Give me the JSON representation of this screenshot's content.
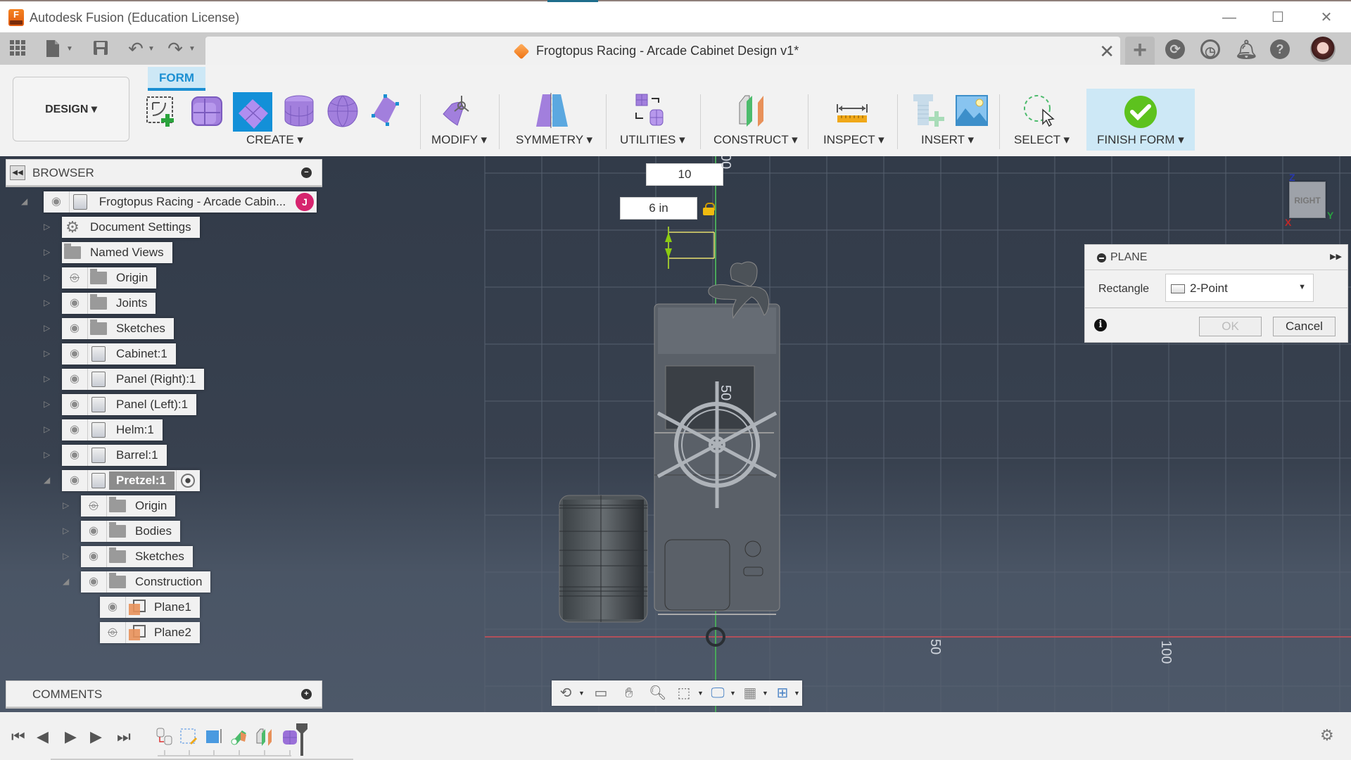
{
  "window": {
    "app_title": "Autodesk Fusion (Education License)",
    "logo_text": "F",
    "controls": {
      "minimize": "—",
      "maximize": "☐",
      "close": "✕"
    }
  },
  "quick_access": {
    "icons": [
      "apps-grid-icon",
      "file-icon",
      "save-icon",
      "undo-icon",
      "redo-icon"
    ]
  },
  "document_tab": {
    "title": "Frogtopus Racing - Arcade Cabinet Design v1*",
    "close": "✕",
    "new_tab": "+"
  },
  "top_right_icons": [
    "extensions-icon",
    "job-status-icon",
    "notifications-icon",
    "help-icon",
    "user-avatar"
  ],
  "ribbon": {
    "workspace": "DESIGN ▾",
    "active_tab": "FORM",
    "groups": [
      {
        "label": "CREATE ▾"
      },
      {
        "label": "MODIFY ▾"
      },
      {
        "label": "SYMMETRY ▾"
      },
      {
        "label": "UTILITIES ▾"
      },
      {
        "label": "CONSTRUCT ▾"
      },
      {
        "label": "INSPECT ▾"
      },
      {
        "label": "INSERT ▾"
      },
      {
        "label": "SELECT ▾"
      },
      {
        "label": "FINISH FORM ▾"
      }
    ],
    "create_tools": [
      "create-sketch",
      "box",
      "plane",
      "cylinder",
      "sphere",
      "face"
    ],
    "active_create_tool": "plane",
    "finish_color": "#5dc21e"
  },
  "browser": {
    "title": "BROWSER",
    "root": {
      "label": "Frogtopus Racing - Arcade Cabin...",
      "badge": "J"
    },
    "items": [
      {
        "label": "Document Settings",
        "icon": "gear",
        "visible": null
      },
      {
        "label": "Named Views",
        "icon": "folder",
        "visible": null
      },
      {
        "label": "Origin",
        "icon": "folder",
        "visible": false
      },
      {
        "label": "Joints",
        "icon": "folder",
        "visible": true
      },
      {
        "label": "Sketches",
        "icon": "folder",
        "visible": true
      },
      {
        "label": "Cabinet:1",
        "icon": "component",
        "visible": true
      },
      {
        "label": "Panel (Right):1",
        "icon": "component",
        "visible": true
      },
      {
        "label": "Panel (Left):1",
        "icon": "component",
        "visible": true
      },
      {
        "label": "Helm:1",
        "icon": "component",
        "visible": true
      },
      {
        "label": "Barrel:1",
        "icon": "component",
        "visible": true
      },
      {
        "label": "Pretzel:1",
        "icon": "component",
        "visible": true,
        "active": true,
        "expanded": true
      }
    ],
    "pretzel_children": [
      {
        "label": "Origin",
        "icon": "folder",
        "visible": false
      },
      {
        "label": "Bodies",
        "icon": "folder",
        "visible": true
      },
      {
        "label": "Sketches",
        "icon": "folder",
        "visible": true
      },
      {
        "label": "Construction",
        "icon": "folder",
        "visible": true,
        "expanded": true
      }
    ],
    "construction_children": [
      {
        "label": "Plane1",
        "icon": "plane",
        "visible": true
      },
      {
        "label": "Plane2",
        "icon": "plane",
        "visible": false
      }
    ]
  },
  "comments": {
    "title": "COMMENTS"
  },
  "canvas": {
    "dimension_inputs": {
      "width_value": "10",
      "height_value": "6 in"
    },
    "grid_labels": {
      "top": "00",
      "center_vertical": "50",
      "bottom_50": "50",
      "bottom_100": "100"
    },
    "view_cube": {
      "face": "RIGHT",
      "axes": {
        "z": "Z",
        "y": "Y",
        "x": "X"
      }
    }
  },
  "plane_dialog": {
    "title": "PLANE",
    "rectangle_label": "Rectangle",
    "rectangle_value": "2-Point",
    "ok": "OK",
    "cancel": "Cancel",
    "ok_enabled": false
  },
  "nav_bar": {
    "icons": [
      "orbit-icon",
      "look-at-icon",
      "pan-icon",
      "zoom-icon",
      "fit-icon",
      "display-settings-icon",
      "grid-settings-icon",
      "viewports-icon"
    ]
  },
  "timeline": {
    "controls": [
      "go-to-start",
      "step-back",
      "play",
      "step-forward",
      "go-to-end"
    ],
    "features": [
      "derive",
      "sketch",
      "extrude",
      "pipe",
      "plane",
      "form"
    ]
  }
}
